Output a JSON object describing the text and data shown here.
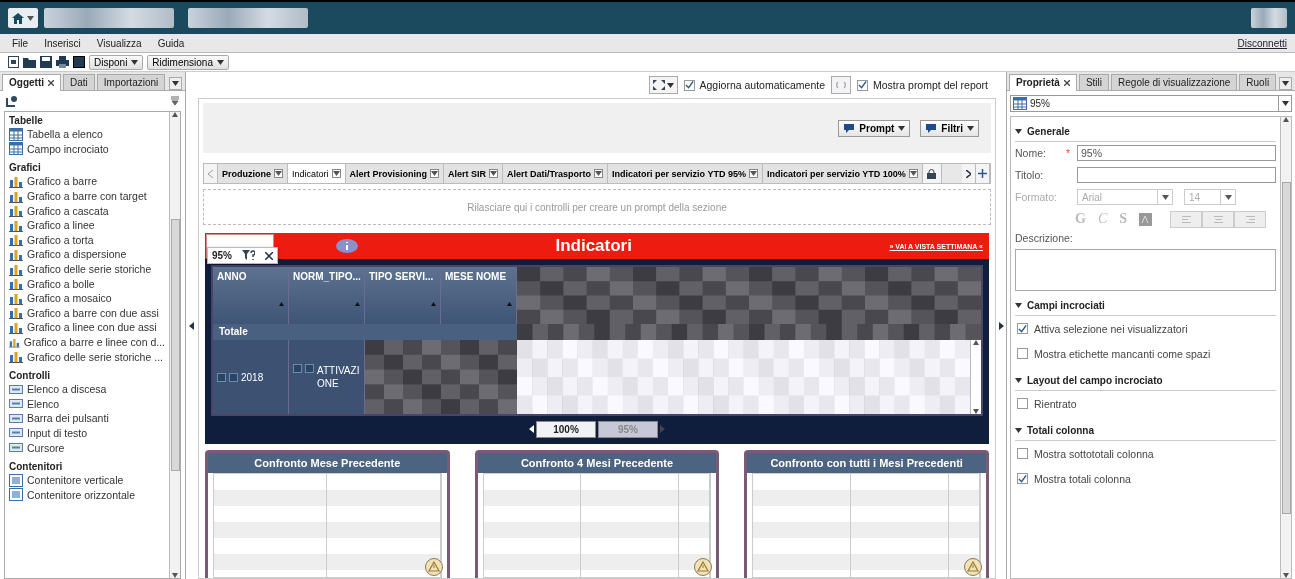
{
  "menu": [
    {
      "label": "File"
    },
    {
      "label": "Inserisci"
    },
    {
      "label": "Visualizza"
    },
    {
      "label": "Guida"
    }
  ],
  "logout_link": "Disconnetti",
  "toolbar": {
    "buttons": [
      {
        "label": "Disponi"
      },
      {
        "label": "Ridimensiona"
      }
    ]
  },
  "left_panel": {
    "tabs": [
      {
        "label": "Oggetti",
        "selected": true
      },
      {
        "label": "Dati",
        "selected": false
      },
      {
        "label": "Importazioni",
        "selected": false
      }
    ],
    "groups": [
      {
        "title": "Tabelle",
        "kind": "table",
        "items": [
          "Tabella a elenco",
          "Campo incrociato"
        ]
      },
      {
        "title": "Grafici",
        "kind": "chart",
        "items": [
          "Grafico a barre",
          "Grafico a barre con target",
          "Grafico a cascata",
          "Grafico a linee",
          "Grafico a torta",
          "Grafico a dispersione",
          "Grafico delle serie storiche",
          "Grafico a bolle",
          "Grafico a mosaico",
          "Grafico a barre con due assi",
          "Grafico a linee con due assi",
          "Grafico a barre e linee con d...",
          "Grafico delle serie storiche ..."
        ]
      },
      {
        "title": "Controlli",
        "kind": "control",
        "items": [
          "Elenco a discesa",
          "Elenco",
          "Barra dei pulsanti",
          "Input di testo",
          "Cursore"
        ]
      },
      {
        "title": "Contenitori",
        "kind": "container",
        "items": [
          "Contenitore verticale",
          "Contenitore orizzontale"
        ]
      }
    ]
  },
  "view_toolbar": {
    "options": [
      {
        "label": "Aggiorna automaticamente",
        "checked": true
      },
      {
        "label": "Mostra prompt del report",
        "checked": true
      }
    ]
  },
  "prompt_buttons": [
    {
      "label": "Prompt"
    },
    {
      "label": "Filtri"
    }
  ],
  "section_tabs": [
    {
      "label": "Produzione",
      "selected": false
    },
    {
      "label": "Indicatori",
      "selected": true
    },
    {
      "label": "Alert Provisioning",
      "selected": false
    },
    {
      "label": "Alert SIR",
      "selected": false
    },
    {
      "label": "Alert Dati/Trasporto",
      "selected": false
    },
    {
      "label": "Indicatori per servizio YTD 95%",
      "selected": false
    },
    {
      "label": "Indicatori per servizio YTD 100%",
      "selected": false
    }
  ],
  "drop_zone": {
    "hint": "Rilasciare qui i controlli per creare un prompt della sezione"
  },
  "banner": {
    "title": "Indicatori",
    "link": "» VAI A VISTA SETTIMANA «"
  },
  "popup": {
    "value": "95%"
  },
  "crosstab": {
    "columns": [
      "ANNO",
      "NORM_TIPO...",
      "TIPO SERVI...",
      "MESE NOME"
    ],
    "total_label": "Totale",
    "rows": [
      {
        "year": "2018",
        "type": "ATTIVAZIONE"
      }
    ]
  },
  "pager": [
    {
      "label": "100%",
      "selected": true
    },
    {
      "label": "95%",
      "selected": false
    }
  ],
  "cards": [
    {
      "title": "Confronto Mese Precedente"
    },
    {
      "title": "Confronto 4 Mesi Precedente"
    },
    {
      "title": "Confronto con tutti i Mesi Precedenti"
    }
  ],
  "right_panel": {
    "tabs": [
      {
        "label": "Proprietà",
        "selected": true
      },
      {
        "label": "Stili",
        "selected": false
      },
      {
        "label": "Regole di visualizzazione",
        "selected": false
      },
      {
        "label": "Ruoli",
        "selected": false
      }
    ],
    "object_select": "95%",
    "general": {
      "title": "Generale",
      "name_label": "Nome:",
      "required_mark": "*",
      "name_value": "95%",
      "title_label": "Titolo:",
      "format_label": "Formato:",
      "font": "Arial",
      "size": "14",
      "style_buttons": [
        "G",
        "C",
        "S"
      ],
      "description_label": "Descrizione:"
    },
    "sections": [
      {
        "title": "Campi incrociati",
        "options": [
          {
            "label": "Attiva selezione nei visualizzatori",
            "checked": true
          },
          {
            "label": "Mostra etichette mancanti come spazi",
            "checked": false
          }
        ]
      },
      {
        "title": "Layout del campo incrociato",
        "options": [
          {
            "label": "Rientrato",
            "checked": false
          }
        ]
      },
      {
        "title": "Totali colonna",
        "options": [
          {
            "label": "Mostra sottototali colonna",
            "checked": false
          },
          {
            "label": "Mostra totali colonna",
            "checked": true
          }
        ]
      }
    ]
  }
}
